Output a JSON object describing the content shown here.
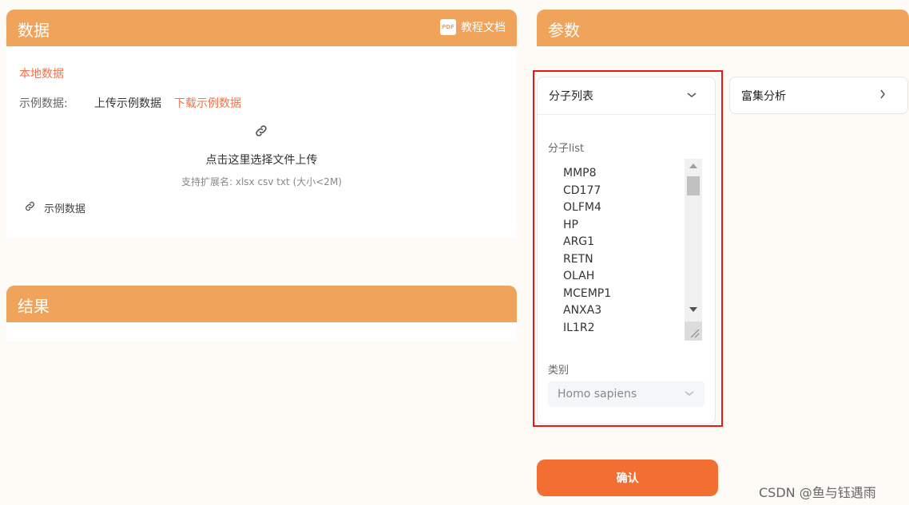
{
  "data_panel": {
    "title": "数据",
    "tutorial_label": "教程文档",
    "pdf_icon_text": "PDF",
    "local_data": "本地数据",
    "sample_label": "示例数据:",
    "upload_sample": "上传示例数据",
    "download_sample": "下载示例数据",
    "upload_click": "点击这里选择文件上传",
    "upload_hint": "支持扩展名: xlsx csv txt (大小<2M)",
    "example_file": "示例数据"
  },
  "result_panel": {
    "title": "结果"
  },
  "param_panel": {
    "title": "参数",
    "molecule_card": {
      "title": "分子列表",
      "list_label": "分子list",
      "molecules": [
        "MMP8",
        "CD177",
        "OLFM4",
        "HP",
        "ARG1",
        "RETN",
        "OLAH",
        "MCEMP1",
        "ANXA3",
        "IL1R2"
      ],
      "category_label": "类别",
      "category_value": "Homo sapiens"
    },
    "enrich_card": {
      "title": "富集分析"
    },
    "confirm_label": "确认"
  },
  "icons": {
    "link": "link-icon",
    "chevron_down": "chevron-down-icon",
    "chevron_right": "chevron-right-icon"
  },
  "colors": {
    "header_orange": "#f0a35a",
    "accent_red": "#f0734a",
    "confirm_orange": "#f26f31",
    "highlight_frame": "#e8171c"
  },
  "watermark": "CSDN @鱼与钰遇雨"
}
